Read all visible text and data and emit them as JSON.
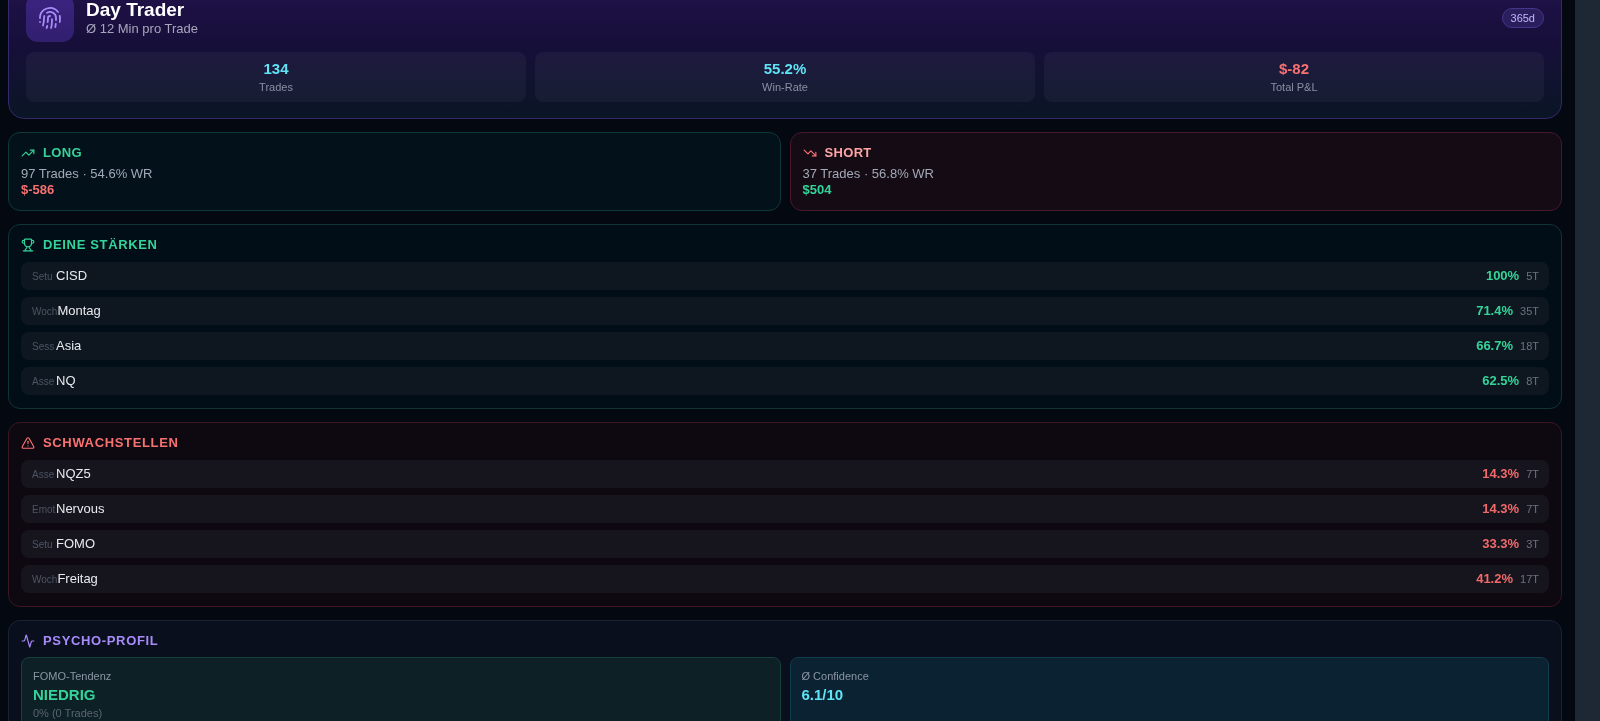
{
  "profile": {
    "title": "Day Trader",
    "subtitle": "Ø 12 Min pro Trade",
    "period": "365d",
    "stats": [
      {
        "value": "134",
        "label": "Trades",
        "color": "#5fe3f5"
      },
      {
        "value": "55.2%",
        "label": "Win-Rate",
        "color": "#5fe3f5"
      },
      {
        "value": "$-82",
        "label": "Total P&L",
        "color": "#f87171"
      }
    ]
  },
  "sides": [
    {
      "kind": "long",
      "title": "LONG",
      "summary": "97 Trades · 54.6% WR",
      "pnl": "$-586",
      "color": "#f87171"
    },
    {
      "kind": "short",
      "title": "SHORT",
      "summary": "37 Trades · 56.8% WR",
      "pnl": "$504",
      "color": "#34d399"
    }
  ],
  "sections": [
    {
      "kind": "strengths",
      "title": "DEINE STÄRKEN",
      "items": [
        {
          "category": "Setu",
          "value": "CISD",
          "rate": "100%",
          "count": "5T"
        },
        {
          "category": "Woch",
          "value": "Montag",
          "rate": "71.4%",
          "count": "35T"
        },
        {
          "category": "Sess",
          "value": "Asia",
          "rate": "66.7%",
          "count": "18T"
        },
        {
          "category": "Asse",
          "value": "NQ",
          "rate": "62.5%",
          "count": "8T"
        }
      ]
    },
    {
      "kind": "weaknesses",
      "title": "SCHWACHSTELLEN",
      "items": [
        {
          "category": "Asse",
          "value": "NQZ5",
          "rate": "14.3%",
          "count": "7T"
        },
        {
          "category": "Emot",
          "value": "Nervous",
          "rate": "14.3%",
          "count": "7T"
        },
        {
          "category": "Setu",
          "value": "FOMO",
          "rate": "33.3%",
          "count": "3T"
        },
        {
          "category": "Woch",
          "value": "Freitag",
          "rate": "41.2%",
          "count": "17T"
        }
      ]
    }
  ],
  "psycho": {
    "title": "PSYCHO-PROFIL",
    "metrics": [
      {
        "kind": "fomo",
        "label": "FOMO-Tendenz",
        "value": "NIEDRIG",
        "note": "0% (0 Trades)"
      },
      {
        "kind": "confidence",
        "label": "Ø Confidence",
        "value": "6.1/10"
      }
    ]
  }
}
